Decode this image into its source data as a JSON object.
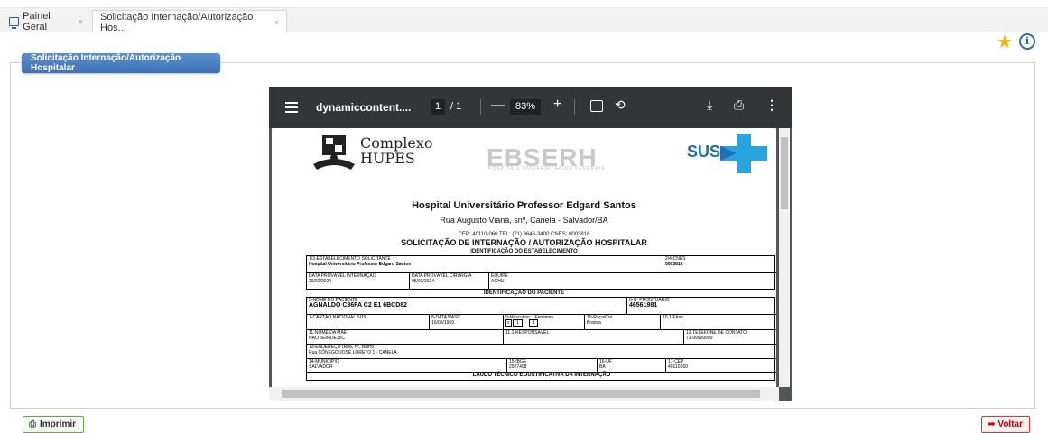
{
  "tabs": [
    {
      "label": "Painel Geral",
      "close": "×"
    },
    {
      "label": "Solicitação Internação/Autorização Hos...",
      "close": "×"
    }
  ],
  "toolbar_icons": {
    "favorite": "star-icon",
    "info": "info-icon",
    "info_glyph": "i"
  },
  "panel": {
    "title": "Solicitação Internação/Autorização Hospitalar"
  },
  "viewer": {
    "filename": "dynamiccontent....",
    "page_current": "1",
    "page_total": "/ 1",
    "zoom": "83%",
    "zoom_out": "—",
    "zoom_in": "+"
  },
  "document": {
    "logo_complexo_line1": "Complexo",
    "logo_complexo_line2": "HUPES",
    "logo_ebserh": "EBSERH",
    "logo_ebserh_sub": "HOSPITAIS UNIVERSITÁRIOS FEDERAIS",
    "logo_sus": "SUS",
    "hospital_name": "Hospital Universitário Professor Edgard Santos",
    "address": "Rua Augusto Viana, snº, Canela - Salvador/BA",
    "contact": "CEP: 40110-060     TEL: (71) 3646-3400   CNES: 0003816",
    "form_title": "SOLICITAÇÃO DE INTERNAÇÃO / AUTORIZAÇÃO HOSPITALAR",
    "section_estab": "IDENTIFICAÇÃO DO ESTABELECIMENTO",
    "lbl_estab": "1/3-ESTABELECIMENTO SOLICITANTE",
    "val_estab": "Hospital Universitário Professor Edgard Santos",
    "lbl_cnes": "2/4-CNES",
    "val_cnes": "0003816",
    "lbl_data_int": "DATA PROVÁVEL INTERNAÇÃO",
    "val_data_int": "29/02/2024",
    "lbl_data_cir": "DATA PROVÁVEL CIRURGIA",
    "val_data_cir": "05/03/2024",
    "lbl_equipe": "EQUIPE",
    "val_equipe": "AGHU",
    "section_paciente": "IDENTIFICAÇÃO DO PACIENTE",
    "lbl_nome": "5-NOME DO PACIENTE",
    "val_nome": "AGNALDO C36FA C2 E1 6BCD82",
    "lbl_pront": "6-Nº PRONTUÁRIO",
    "val_pront": "46561981",
    "lbl_cartao": "7-CARTÃO NACIONAL SUS",
    "lbl_nasc": "8-DATA NASC.",
    "val_nasc": "16/05/1969",
    "lbl_sexo_m": "9-Masculino",
    "lbl_sexo_f": "Feminino",
    "val_sexo_x": "x",
    "val_sexo_1": "1",
    "val_sexo_3": "3",
    "lbl_raca": "10-Raça/Cor",
    "val_raca": "Branca",
    "lbl_etnia": "10.1-Etnia",
    "lbl_mae": "11-NOME DA MÃE",
    "val_mae": "NAO 6E84DE35C",
    "lbl_resp": "11.1-RESPONSÁVEL",
    "lbl_tel": "12-TELEFONE DE CONTATO",
    "val_tel": "71-99999999",
    "lbl_end": "13-ENDEREÇO (Rua, Nº, Bairro )",
    "val_end": "Rua CÔNEGO JOSÉ LORETO 1 - CANELA",
    "lbl_mun": "14-MUNICÍPIO",
    "val_mun": "SALVADOR",
    "lbl_ibge": "15-IBGE",
    "val_ibge": "2927408",
    "lbl_uf": "16-UF",
    "val_uf": "BA",
    "lbl_cep": "17-CEP",
    "val_cep": "40110160",
    "section_laudo": "LAUDO TÉCNICO E JUSTIFICATIVA DA INTERNAÇÃO"
  },
  "buttons": {
    "print": "Imprimir",
    "back": "Voltar"
  },
  "colors": {
    "accent": "#3f72b5",
    "star": "#f2b400",
    "print_border": "#6aa84f",
    "back": "#cc0000",
    "viewer_bar": "#323639"
  }
}
